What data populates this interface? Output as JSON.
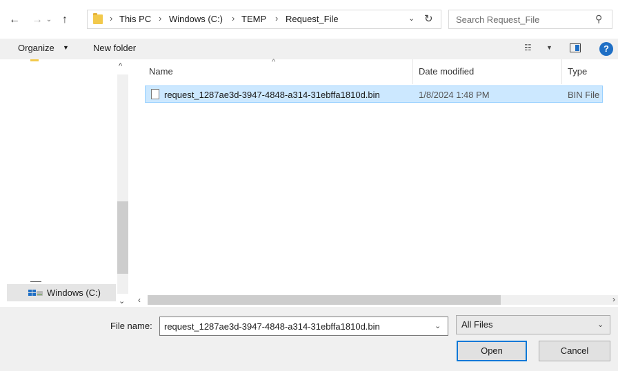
{
  "address": {
    "path": [
      "This PC",
      "Windows (C:)",
      "TEMP",
      "Request_File"
    ]
  },
  "search": {
    "placeholder": "Search Request_File"
  },
  "toolbar": {
    "organize_label": "Organize",
    "new_folder_label": "New folder"
  },
  "nav_pane": {
    "selected_drive": "Windows (C:)"
  },
  "file_list": {
    "columns": [
      "Name",
      "Date modified",
      "Type"
    ],
    "rows": [
      {
        "name": "request_1287ae3d-3947-4848-a314-31ebffa1810d.bin",
        "date_modified": "1/8/2024 1:48 PM",
        "type": "BIN File",
        "selected": true
      }
    ]
  },
  "bottom": {
    "file_name_label": "File name:",
    "file_name_value": "request_1287ae3d-3947-4848-a314-31ebffa1810d.bin",
    "filter_value": "All Files",
    "open_label": "Open",
    "cancel_label": "Cancel"
  },
  "colors": {
    "accent": "#0078d7",
    "selection_bg": "#cce8ff",
    "selection_border": "#99d1ff",
    "folder": "#f2c94c"
  },
  "icons": [
    "back-arrow-icon",
    "forward-arrow-icon",
    "recent-locations-icon",
    "up-arrow-icon",
    "folder-icon",
    "refresh-icon",
    "search-icon",
    "view-options-icon",
    "preview-pane-icon",
    "help-icon",
    "drive-icon",
    "file-icon"
  ]
}
